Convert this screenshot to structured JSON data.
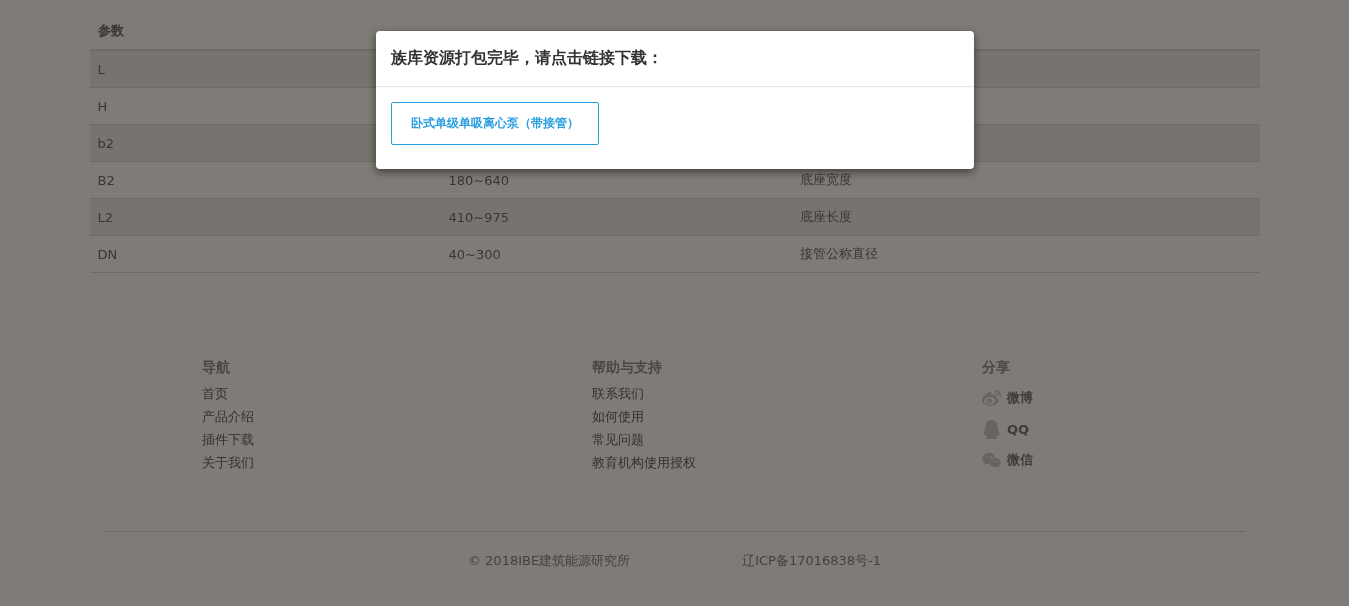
{
  "table": {
    "columns": [
      "参数"
    ],
    "rows": [
      {
        "param": "L"
      },
      {
        "param": "H"
      },
      {
        "param": "b2"
      },
      {
        "param": "B2",
        "value": "180~640",
        "desc": "底座宽度"
      },
      {
        "param": "L2",
        "value": "410~975",
        "desc": "底座长度"
      },
      {
        "param": "DN",
        "value": "40~300",
        "desc": "接管公称直径"
      }
    ]
  },
  "footer": {
    "columns": [
      {
        "kind": "links",
        "title": "导航",
        "items": [
          "首页",
          "产品介绍",
          "插件下载",
          "关于我们"
        ]
      },
      {
        "kind": "links",
        "title": "帮助与支持",
        "items": [
          "联系我们",
          "如何使用",
          "常见问题",
          "教育机构使用授权"
        ]
      },
      {
        "kind": "share",
        "title": "分享",
        "items": [
          "微博",
          "QQ",
          "微信"
        ]
      }
    ],
    "copyright": "© 2018IBE建筑能源研究所",
    "icp": "辽ICP备17016838号-1"
  },
  "modal": {
    "title": "族库资源打包完毕，请点击链接下载：",
    "links": [
      "卧式单级单吸离心泵（带接管）"
    ]
  }
}
